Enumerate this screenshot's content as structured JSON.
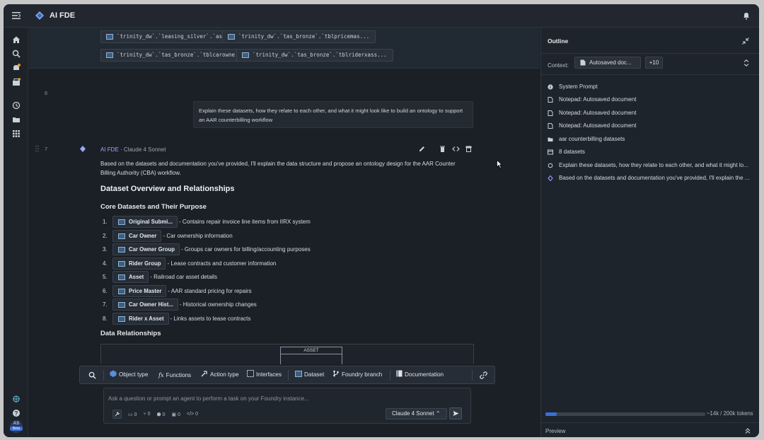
{
  "app": {
    "title": "AI FDE"
  },
  "sidebar": {
    "items": [
      {
        "icon": "home-icon"
      },
      {
        "icon": "search-icon"
      },
      {
        "icon": "notifications-icon"
      },
      {
        "icon": "apps-badge-icon"
      },
      {
        "icon": "history-icon"
      },
      {
        "icon": "folder-icon"
      },
      {
        "icon": "grid-icon"
      }
    ],
    "bottom": [
      {
        "icon": "ontology-icon"
      },
      {
        "icon": "help-icon"
      }
    ],
    "avatar": "AS",
    "beta": "Beta"
  },
  "context_chips": [
    "`trinity_dw`.`leasing_silver`.`asset`",
    "`trinity_dw`.`tas_bronze`.`tblpricemas...",
    "`trinity_dw`.`tas_bronze`.`tblcarowne...",
    "`trinity_dw`.`tas_bronze`.`tblriderxass..."
  ],
  "blocks": {
    "prompt_num": "6",
    "prompt_text": "Explain these datasets, how they relate to each other, and what it might look like to build an ontology to support an AAR counterbilling workflow",
    "response_num": "7",
    "response_author": "AI FDE",
    "response_sep": "·",
    "response_model": "Claude 4 Sonnet",
    "intro": "Based on the datasets and documentation you've provided, I'll explain the data structure and propose an ontology design for the AAR Counter Billing Authority (CBA) workflow.",
    "h2": "Dataset Overview and Relationships",
    "h3_core": "Core Datasets and Their Purpose",
    "datasets": [
      {
        "num": "1.",
        "name": "Original Submi...",
        "desc": "- Contains repair invoice line items from IIRX system"
      },
      {
        "num": "2.",
        "name": "Car Owner",
        "desc": "- Car ownership information"
      },
      {
        "num": "3.",
        "name": "Car Owner Group",
        "desc": "- Groups car owners for billing/accounting purposes"
      },
      {
        "num": "4.",
        "name": "Rider Group",
        "desc": "- Lease contracts and customer information"
      },
      {
        "num": "5.",
        "name": "Asset",
        "desc": "- Railroad car asset details"
      },
      {
        "num": "6.",
        "name": "Price Master",
        "desc": "- AAR standard pricing for repairs"
      },
      {
        "num": "7.",
        "name": "Car Owner Hist...",
        "desc": "- Historical ownership changes"
      },
      {
        "num": "8.",
        "name": "Rider x Asset",
        "desc": "- Links assets to lease contracts"
      }
    ],
    "h3_rel": "Data Relationships",
    "diagram_label": "ASSET"
  },
  "toolbar": {
    "object_type": "Object type",
    "functions": "Functions",
    "action_type": "Action type",
    "interfaces": "Interfaces",
    "dataset": "Dataset",
    "foundry_branch": "Foundry branch",
    "documentation": "Documentation"
  },
  "composer": {
    "placeholder": "Ask a question or prompt an agent to perform a task on your Foundry instance...",
    "counts": [
      "0",
      "0",
      "0",
      "0",
      "0"
    ],
    "model": "Claude 4 Sonnet"
  },
  "outline": {
    "title": "Outline",
    "context_label": "Context:",
    "context_doc": "Autosaved doc...",
    "context_more": "+10",
    "items": [
      {
        "icon": "info-icon",
        "label": "System Prompt"
      },
      {
        "icon": "document-icon",
        "label": "Notepad: Autosaved document"
      },
      {
        "icon": "document-icon",
        "label": "Notepad: Autosaved document"
      },
      {
        "icon": "document-icon",
        "label": "Notepad: Autosaved document"
      },
      {
        "icon": "folder-icon",
        "label": "aar counterbilling datasets"
      },
      {
        "icon": "table-icon",
        "label": "8 datasets"
      },
      {
        "icon": "circle-icon",
        "label": "Explain these datasets, how they relate to each other, and what it might lo..."
      },
      {
        "icon": "diamond-icon",
        "label": "Based on the datasets and documentation you've provided, I'll explain the ..."
      }
    ],
    "tokens": "~14k / 200k tokens",
    "token_fraction": 0.07,
    "preview": "Preview"
  },
  "colors": {
    "accent": "#3b6fd9",
    "ai": "#9aa7ff",
    "background": "#1b2026"
  }
}
